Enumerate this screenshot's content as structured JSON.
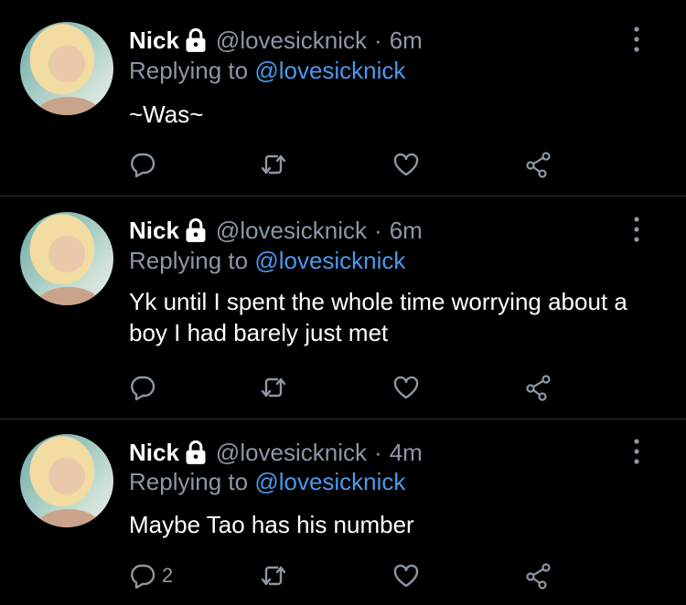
{
  "tweets": [
    {
      "name": "Nick",
      "handle": "@lovesicknick",
      "separator": "·",
      "time": "6m",
      "replying_prefix": "Replying to",
      "replying_to": "@lovesicknick",
      "text": "~Was~",
      "reply_count": "",
      "icons": [
        "reply-icon",
        "retweet-icon",
        "like-icon",
        "share-icon",
        "more-icon",
        "lock-icon"
      ]
    },
    {
      "name": "Nick",
      "handle": "@lovesicknick",
      "separator": "·",
      "time": "6m",
      "replying_prefix": "Replying to",
      "replying_to": "@lovesicknick",
      "text": "Yk until I spent the whole time worrying about a boy I had barely just met",
      "reply_count": ""
    },
    {
      "name": "Nick",
      "handle": "@lovesicknick",
      "separator": "·",
      "time": "4m",
      "replying_prefix": "Replying to",
      "replying_to": "@lovesicknick",
      "text": "Maybe Tao has his number",
      "reply_count": "2"
    }
  ],
  "colors": {
    "background": "#000000",
    "text": "#ffffff",
    "secondary": "#8b98a5",
    "mention": "#4a99e9",
    "divider": "#2f3336"
  }
}
